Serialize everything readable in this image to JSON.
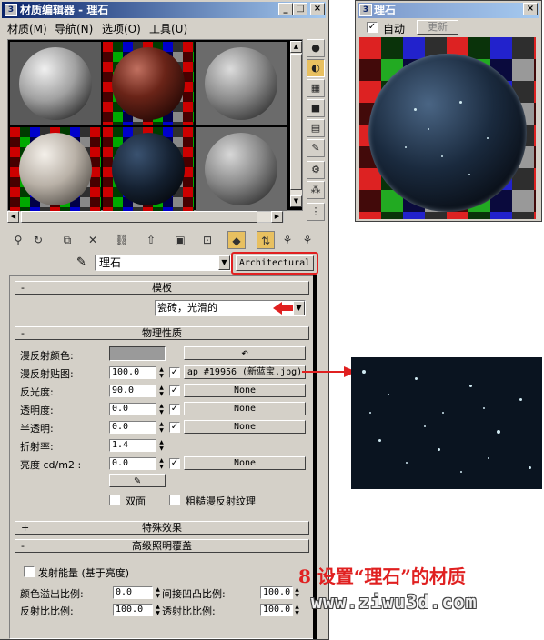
{
  "editor": {
    "title": "材质编辑器 - 理石",
    "window_buttons": [
      "_",
      "□",
      "×"
    ],
    "menus": [
      "材质(M)",
      "导航(N)",
      "选项(O)",
      "工具(U)"
    ],
    "material_name": "理石",
    "material_type": "Architectural",
    "template_rollout": "模板",
    "template_value": "瓷砖，光滑的",
    "physical_rollout": "物理性质",
    "diffuse_color_label": "漫反射颜色:",
    "diffuse_map_label": "漫反射贴图:",
    "diffuse_map_value": "100.0",
    "diffuse_map_name": "ap #19956 (新蓝宝.jpg)",
    "shininess_label": "反光度:",
    "shininess_value": "90.0",
    "transparency_label": "透明度:",
    "transparency_value": "0.0",
    "translucency_label": "半透明:",
    "translucency_value": "0.0",
    "refraction_label": "折射率:",
    "refraction_value": "1.4",
    "luminance_label": "亮度 cd/m2 :",
    "luminance_value": "0.0",
    "none_label": "None",
    "two_sided_label": "双面",
    "rough_diffuse_label": "粗糙漫反射纹理",
    "special_effects_rollout": "特殊效果",
    "adv_lighting_rollout": "高级照明覆盖",
    "emit_energy_label": "发射能量 (基于亮度)",
    "color_bleed_label": "颜色溢出比例:",
    "color_bleed_value": "0.0",
    "indirect_bump_label": "间接凹凸比例:",
    "indirect_bump_value": "100.0",
    "reflectance_label": "反射比比例:",
    "reflectance_value": "100.0",
    "transmittance_label": "透射比比例:",
    "transmittance_value": "100.0",
    "minus": "-",
    "plus": "+"
  },
  "preview": {
    "title": "理石",
    "auto_label": "自动",
    "update_label": "更新"
  },
  "caption": "8 设置“理石”的材质",
  "watermark": "www.ziwu3d.com",
  "colors": {
    "accent": "#e02020",
    "title_active": "#0a246a",
    "face": "#d4d0c8"
  }
}
